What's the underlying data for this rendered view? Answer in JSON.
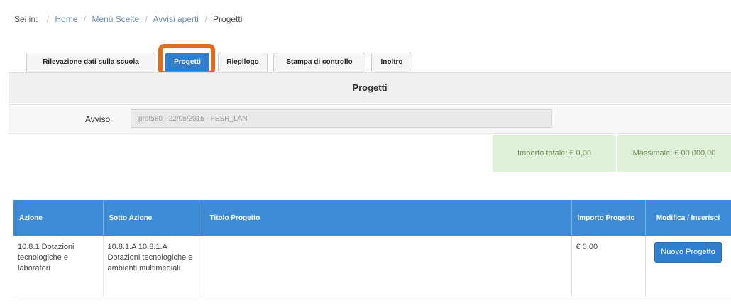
{
  "breadcrumb": {
    "prefix": "Sei in:",
    "items": [
      "Home",
      "Menù Scelte",
      "Avvisi aperti"
    ],
    "current": "Progetti"
  },
  "tabs": [
    {
      "label": "Rilevazione dati sulla scuola",
      "active": false
    },
    {
      "label": "Progetti",
      "active": true
    },
    {
      "label": "Riepilogo",
      "active": false
    },
    {
      "label": "Stampa di controllo",
      "active": false
    },
    {
      "label": "Inoltro",
      "active": false
    }
  ],
  "panel": {
    "title": "Progetti",
    "avviso_label": "Avviso",
    "avviso_value": "prot580 - 22/05/2015 - FESR_LAN",
    "importo_totale": "Importo totale: € 0,00",
    "massimale": "Massimale: € 00.000,00"
  },
  "table": {
    "headers": [
      "Azione",
      "Sotto Azione",
      "Titolo Progetto",
      "Importo Progetto",
      "Modifica / Inserisci"
    ],
    "rows": [
      {
        "azione": "10.8.1 Dotazioni tecnologiche e laboratori",
        "sotto_azione": "10.8.1.A 10.8.1.A Dotazioni tecnologiche e ambienti multimediali",
        "titolo": "",
        "importo": "€ 0,00",
        "button_label": "Nuovo Progetto"
      }
    ]
  },
  "colors": {
    "accent": "#2f7fce",
    "table_header": "#3d8bd4",
    "highlight": "#e66a18",
    "success_bg": "#dff0d8"
  }
}
